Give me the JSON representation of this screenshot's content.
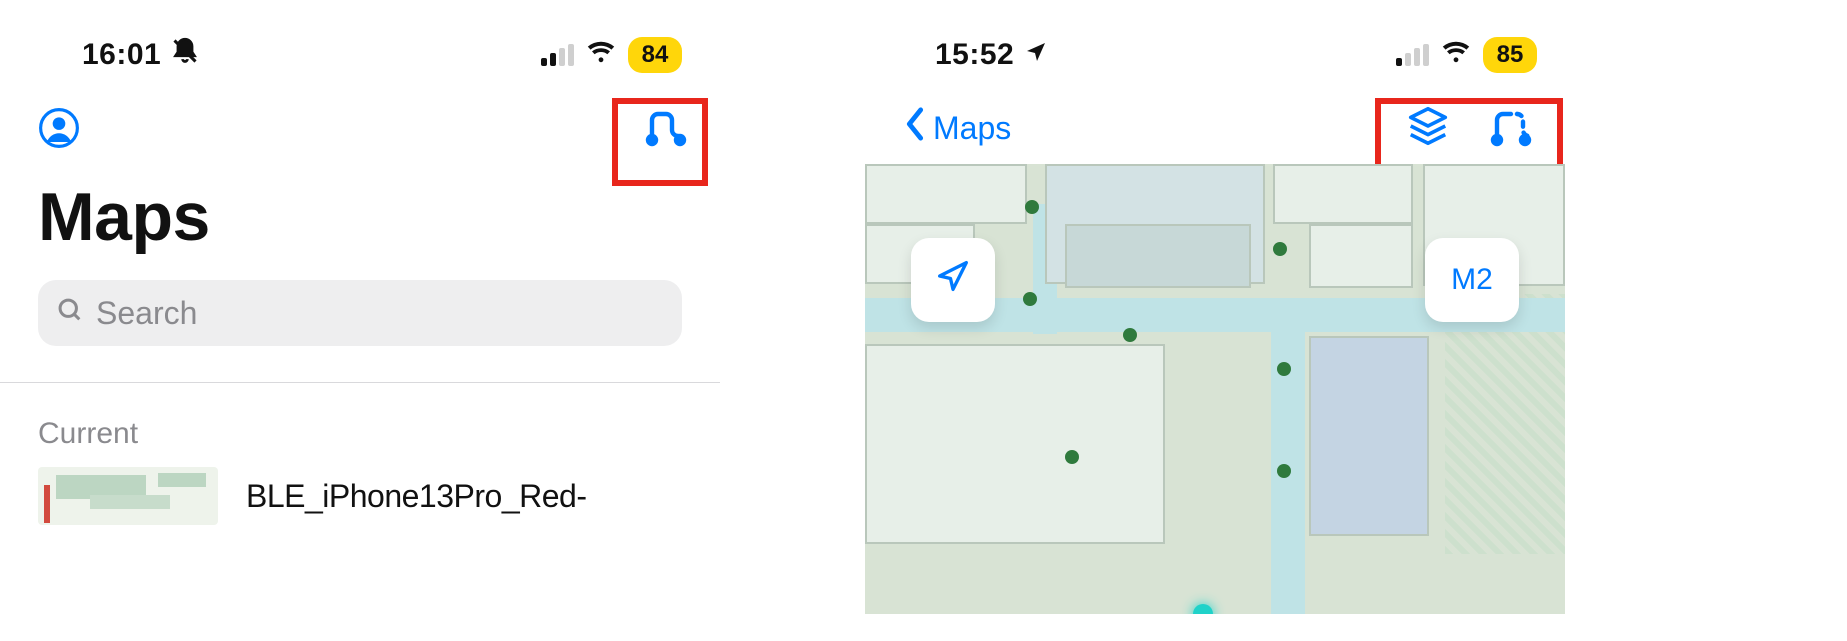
{
  "left": {
    "status": {
      "time": "16:01",
      "silent": true,
      "signal_bars_active": 2,
      "signal_bars_total": 4,
      "wifi": true,
      "battery_pct": "84"
    },
    "nav": {
      "profile_icon": "person-circle-icon",
      "route_icon": "route-icon"
    },
    "title": "Maps",
    "search": {
      "placeholder": "Search"
    },
    "section_label": "Current",
    "current_item": {
      "title": "BLE_iPhone13Pro_Red-"
    }
  },
  "right": {
    "status": {
      "time": "15:52",
      "location_arrow": true,
      "signal_bars_active": 1,
      "signal_bars_total": 4,
      "wifi": true,
      "battery_pct": "85"
    },
    "nav": {
      "back_label": "Maps",
      "layers_icon": "layers-icon",
      "route_icon": "route-dashed-icon"
    },
    "float": {
      "locate_icon": "location-arrow-icon",
      "floor_label": "M2"
    }
  },
  "colors": {
    "accent": "#007aff",
    "highlight": "#e8261c",
    "battery_pill": "#ffd60a"
  }
}
